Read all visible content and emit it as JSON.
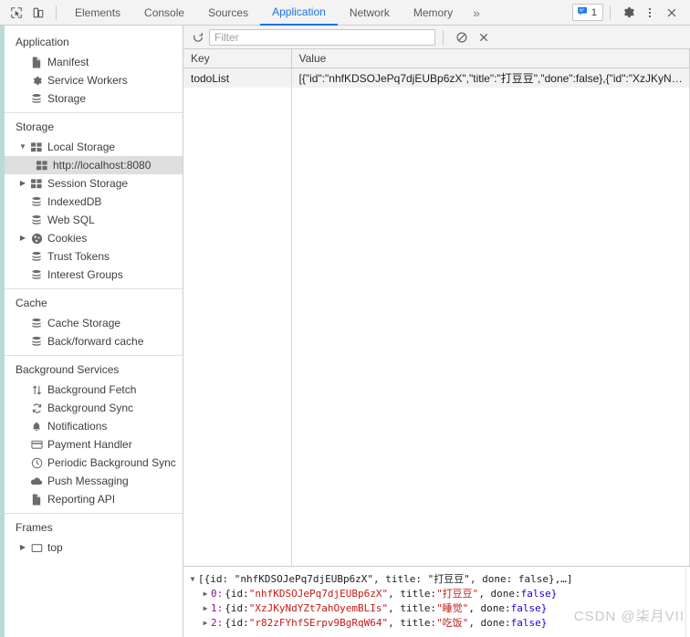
{
  "tabbar": {
    "inspect_icon": "inspect-cursor-icon",
    "device_icon": "device-toolbar-icon",
    "tabs": [
      {
        "label": "Elements",
        "active": false
      },
      {
        "label": "Console",
        "active": false
      },
      {
        "label": "Sources",
        "active": false
      },
      {
        "label": "Application",
        "active": true
      },
      {
        "label": "Network",
        "active": false
      },
      {
        "label": "Memory",
        "active": false
      }
    ],
    "more_label": "»",
    "issues_count": "1",
    "issues_icon": "issues-message-icon",
    "settings_icon": "gear-icon",
    "kebab_icon": "more-vertical-icon",
    "close_icon": "close-icon"
  },
  "sidebar": {
    "groups": [
      {
        "title": "Application",
        "items": [
          {
            "label": "Manifest",
            "icon": "manifest-file-icon",
            "level": 1,
            "twisty": "",
            "selected": false
          },
          {
            "label": "Service Workers",
            "icon": "gear-icon",
            "level": 1,
            "twisty": "",
            "selected": false
          },
          {
            "label": "Storage",
            "icon": "database-icon",
            "level": 1,
            "twisty": "",
            "selected": false
          }
        ]
      },
      {
        "title": "Storage",
        "items": [
          {
            "label": "Local Storage",
            "icon": "table-grid-icon",
            "level": 1,
            "twisty": "▼",
            "selected": false
          },
          {
            "label": "http://localhost:8080",
            "icon": "table-grid-icon",
            "level": 2,
            "twisty": "",
            "selected": true
          },
          {
            "label": "Session Storage",
            "icon": "table-grid-icon",
            "level": 1,
            "twisty": "▶",
            "selected": false
          },
          {
            "label": "IndexedDB",
            "icon": "database-icon",
            "level": 1,
            "twisty": "",
            "selected": false
          },
          {
            "label": "Web SQL",
            "icon": "database-icon",
            "level": 1,
            "twisty": "",
            "selected": false
          },
          {
            "label": "Cookies",
            "icon": "cookie-icon",
            "level": 1,
            "twisty": "▶",
            "selected": false
          },
          {
            "label": "Trust Tokens",
            "icon": "database-icon",
            "level": 1,
            "twisty": "",
            "selected": false
          },
          {
            "label": "Interest Groups",
            "icon": "database-icon",
            "level": 1,
            "twisty": "",
            "selected": false
          }
        ]
      },
      {
        "title": "Cache",
        "items": [
          {
            "label": "Cache Storage",
            "icon": "database-icon",
            "level": 1,
            "twisty": "",
            "selected": false
          },
          {
            "label": "Back/forward cache",
            "icon": "database-icon",
            "level": 1,
            "twisty": "",
            "selected": false
          }
        ]
      },
      {
        "title": "Background Services",
        "items": [
          {
            "label": "Background Fetch",
            "icon": "arrows-updown-icon",
            "level": 1,
            "twisty": "",
            "selected": false
          },
          {
            "label": "Background Sync",
            "icon": "sync-icon",
            "level": 1,
            "twisty": "",
            "selected": false
          },
          {
            "label": "Notifications",
            "icon": "bell-icon",
            "level": 1,
            "twisty": "",
            "selected": false
          },
          {
            "label": "Payment Handler",
            "icon": "credit-card-icon",
            "level": 1,
            "twisty": "",
            "selected": false
          },
          {
            "label": "Periodic Background Sync",
            "icon": "clock-icon",
            "level": 1,
            "twisty": "",
            "selected": false
          },
          {
            "label": "Push Messaging",
            "icon": "cloud-icon",
            "level": 1,
            "twisty": "",
            "selected": false
          },
          {
            "label": "Reporting API",
            "icon": "file-icon",
            "level": 1,
            "twisty": "",
            "selected": false
          }
        ]
      },
      {
        "title": "Frames",
        "items": [
          {
            "label": "top",
            "icon": "frame-icon",
            "level": 1,
            "twisty": "▶",
            "selected": false
          }
        ]
      }
    ]
  },
  "filterbar": {
    "refresh_icon": "refresh-icon",
    "filter_placeholder": "Filter",
    "filter_value": "",
    "clear_all_icon": "clear-all-icon",
    "delete_icon": "delete-x-icon"
  },
  "table": {
    "headers": [
      "Key",
      "Value"
    ],
    "rows": [
      {
        "key": "todoList",
        "value": "[{\"id\":\"nhfKDSOJePq7djEUBp6zX\",\"title\":\"打豆豆\",\"done\":false},{\"id\":\"XzJKyN…"
      }
    ]
  },
  "preview": {
    "root": {
      "twisty": "▼",
      "text": "[{id: \"nhfKDSOJePq7djEUBp6zX\", title: \"打豆豆\", done: false},…]"
    },
    "entries": [
      {
        "twisty": "▶",
        "index": "0:",
        "id_key": "{id: ",
        "id_value": "\"nhfKDSOJePq7djEUBp6zX\"",
        "title_key": ", title: ",
        "title_value": "\"打豆豆\"",
        "done_key": ", done: ",
        "done_value": "false}"
      },
      {
        "twisty": "▶",
        "index": "1:",
        "id_key": "{id: ",
        "id_value": "\"XzJKyNdYZt7ahOyemBLIs\"",
        "title_key": ", title: ",
        "title_value": "\"睡觉\"",
        "done_key": ", done: ",
        "done_value": "false}"
      },
      {
        "twisty": "▶",
        "index": "2:",
        "id_key": "{id: ",
        "id_value": "\"r82zFYhfSErpv9BgRqW64\"",
        "title_key": ", title: ",
        "title_value": "\"吃饭\"",
        "done_key": ", done: ",
        "done_value": "false}"
      }
    ],
    "watermark": "CSDN @柒月VII"
  },
  "colors": {
    "accent": "#1a73e8",
    "left_strip": "#bcd9da",
    "selection": "#dedede",
    "chrome_bg": "#f3f3f3"
  }
}
